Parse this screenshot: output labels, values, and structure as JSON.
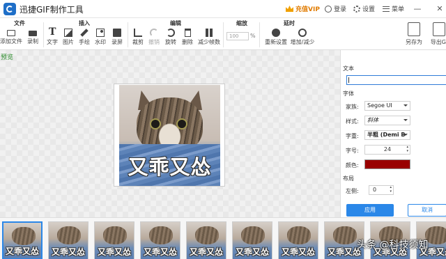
{
  "app": {
    "title": "迅捷GIF制作工具",
    "vip_label": "充值VIP",
    "login_label": "登录",
    "settings_label": "设置",
    "menu_label": "菜单",
    "minimize": "—",
    "maximize": "☐",
    "close": "✕"
  },
  "toolbar": {
    "groups": {
      "file": "文件",
      "insert": "插入",
      "edit": "编辑",
      "zoom": "缩放",
      "delay": "延时"
    },
    "file": {
      "add_file": "添加文件",
      "record": "录制"
    },
    "insert": {
      "text": "文字",
      "image": "图片",
      "draw": "手绘",
      "watermark": "水印",
      "screen_record": "录屏"
    },
    "edit": {
      "crop": "裁剪",
      "undo": "撤销",
      "rotate": "旋转",
      "delete": "删除",
      "reduce_frames": "减少帧数"
    },
    "zoom": {
      "value": "100",
      "unit": "%"
    },
    "delay": {
      "reset": "重新设置",
      "add_reduce": "增加/减少"
    },
    "save_as": "另存为",
    "export": "导出GI"
  },
  "canvas": {
    "preview_label": "预览",
    "gif_caption": "又乖又怂"
  },
  "panel": {
    "text_section": "文本",
    "text_value": "",
    "font_section": "字体",
    "family_label": "家族:",
    "family_value": "Segoe UI",
    "style_label": "样式:",
    "style_value": "斜体",
    "weight_label": "字重:",
    "weight_value": "半粗 (Demi B",
    "size_label": "字号:",
    "size_value": "24",
    "color_label": "颜色:",
    "color_value": "#990000",
    "layout_section": "布局",
    "left_label": "左侧:",
    "left_value": "0",
    "apply_label": "应用",
    "cancel_label": "取消"
  },
  "filmstrip": {
    "frames": [
      {
        "caption": "又乖又怂",
        "selected": true
      },
      {
        "caption": "又乖又怂",
        "selected": false
      },
      {
        "caption": "又乖又怂",
        "selected": false
      },
      {
        "caption": "又乖又怂",
        "selected": false
      },
      {
        "caption": "又乖又怂",
        "selected": false
      },
      {
        "caption": "又乖又怂",
        "selected": false
      },
      {
        "caption": "又乖又怂",
        "selected": false
      },
      {
        "caption": "又乖又怂",
        "selected": false
      },
      {
        "caption": "又乖又怂",
        "selected": false
      },
      {
        "caption": "又乖又怂",
        "selected": false
      }
    ],
    "watermark": "头条 @科技须知"
  },
  "colors": {
    "accent": "#2a87e8",
    "vip": "#e07b00",
    "preview_green": "#2b8a2b",
    "text_color_swatch": "#990000"
  }
}
